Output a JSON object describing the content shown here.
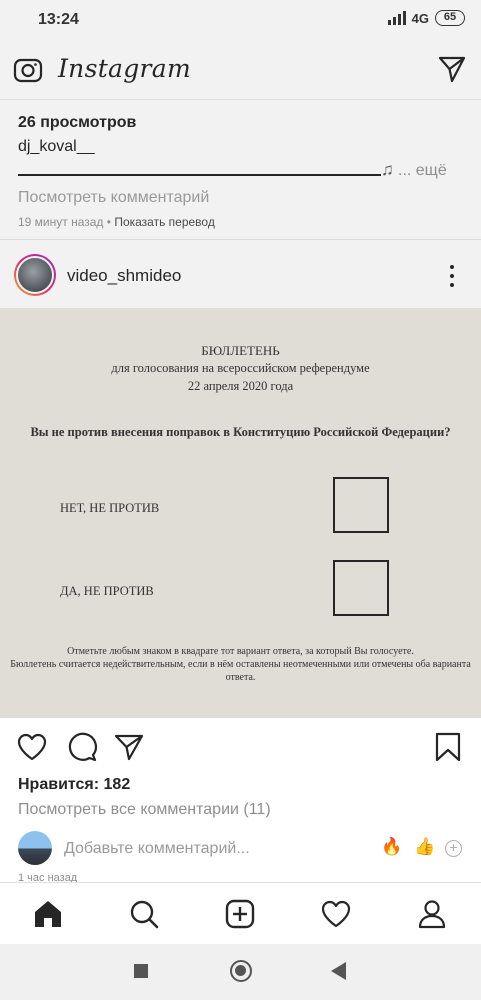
{
  "status_bar": {
    "time": "13:24",
    "network": "4G",
    "battery": "65"
  },
  "header": {
    "logo": "Instagram",
    "left_icon": "camera-icon",
    "right_icon": "direct-message-icon"
  },
  "story_info": {
    "views": "26 просмотров",
    "username": "dj_koval__",
    "more": "... ещё",
    "view_comment": "Посмотреть комментарий",
    "time_ago": "19 минут назад",
    "separator": " • ",
    "translate": "Показать перевод"
  },
  "post": {
    "username": "video_shmideo",
    "ballot": {
      "title": "БЮЛЛЕТЕНЬ",
      "subtitle": "для голосования на всероссийском референдуме",
      "date": "22 апреля 2020 года",
      "question": "Вы не против внесения поправок в Конституцию Российской Федерации?",
      "options": [
        "НЕТ, НЕ ПРОТИВ",
        "ДА, НЕ ПРОТИВ"
      ],
      "instruction_1": "Отметьте любым знаком в квадрате тот вариант ответа, за который Вы голосуете.",
      "instruction_2": "Бюллетень считается недействительным, если в нём оставлены неотмеченными или отмечены оба варианта ответа."
    },
    "likes": "Нравится: 182",
    "view_all_comments": "Посмотреть все комментарии (11)",
    "comment_placeholder": "Добавьте комментарий...",
    "quick_emojis": [
      "🔥",
      "👍"
    ],
    "time_ago": "1 час назад"
  },
  "bottom_nav": [
    "home-icon",
    "search-icon",
    "new-post-icon",
    "activity-heart-icon",
    "profile-icon"
  ],
  "colors": {
    "background": "#ffffff",
    "header_bg": "#f2f2f2",
    "ballot_bg": "#e0ddd7",
    "text": "#262626",
    "muted": "#8e8e8e"
  }
}
